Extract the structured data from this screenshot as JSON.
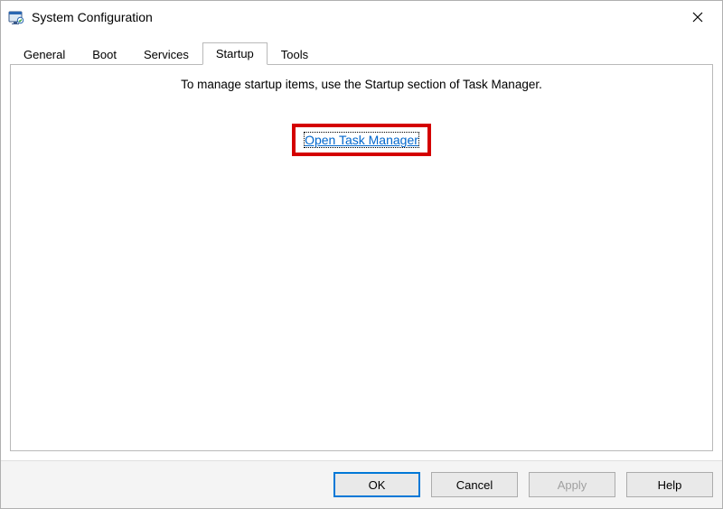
{
  "window": {
    "title": "System Configuration"
  },
  "tabs": {
    "general": "General",
    "boot": "Boot",
    "services": "Services",
    "startup": "Startup",
    "tools": "Tools",
    "active": "startup"
  },
  "startup_tab": {
    "message": "To manage startup items, use the Startup section of Task Manager.",
    "link_label": "Open Task Manager"
  },
  "buttons": {
    "ok": "OK",
    "cancel": "Cancel",
    "apply": "Apply",
    "help": "Help"
  }
}
